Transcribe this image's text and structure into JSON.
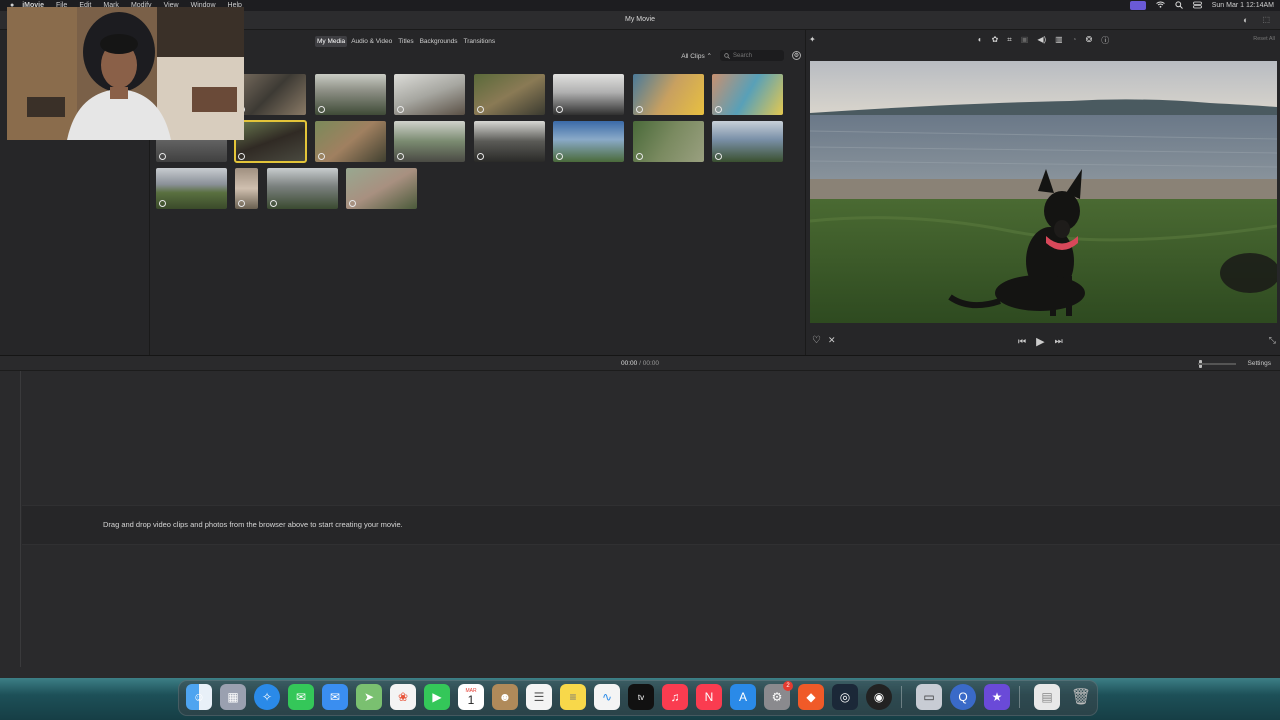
{
  "menubar": {
    "app_name": "iMovie",
    "items": [
      "File",
      "Edit",
      "Mark",
      "Modify",
      "View",
      "Window",
      "Help"
    ],
    "clock": "Sun Mar 1  12:14AM"
  },
  "window": {
    "title": "My Movie"
  },
  "browser": {
    "tabs": [
      "My Media",
      "Audio & Video",
      "Titles",
      "Backgrounds",
      "Transitions"
    ],
    "active_tab": "My Media",
    "filter": "All Clips",
    "search_placeholder": "Search"
  },
  "viewer": {
    "reset_all": "Reset All"
  },
  "timeline": {
    "current_time": "00:00",
    "separator": "/",
    "total_time": "00:00",
    "settings_label": "Settings",
    "empty_message": "Drag and drop video clips and photos from the browser above to start creating your movie."
  },
  "dock": {
    "calendar_month": "MAR",
    "calendar_day": "1",
    "settings_badge": "2",
    "tv_label": "tv"
  }
}
